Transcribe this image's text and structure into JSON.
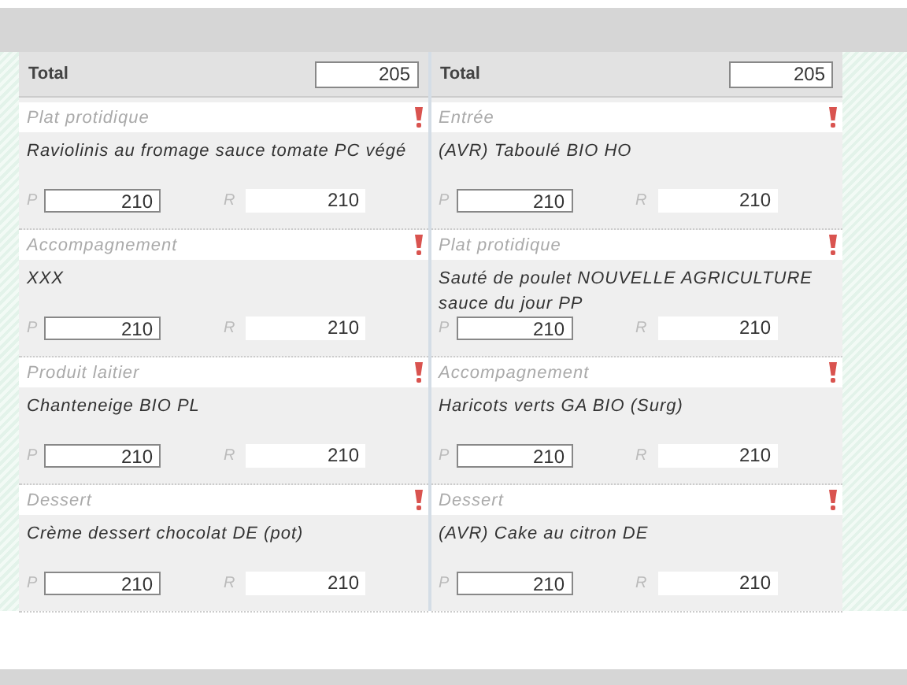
{
  "columns": [
    {
      "total_label": "Total",
      "total_value": "205",
      "sections": [
        {
          "category": "Plat protidique",
          "dish": "Raviolinis au fromage sauce tomate PC végé",
          "p_label": "P",
          "p_value": "210",
          "r_label": "R",
          "r_value": "210"
        },
        {
          "category": "Accompagnement",
          "dish": "XXX",
          "p_label": "P",
          "p_value": "210",
          "r_label": "R",
          "r_value": "210"
        },
        {
          "category": "Produit laitier",
          "dish": "Chanteneige BIO PL",
          "p_label": "P",
          "p_value": "210",
          "r_label": "R",
          "r_value": "210"
        },
        {
          "category": "Dessert",
          "dish": "Crème dessert chocolat DE (pot)",
          "p_label": "P",
          "p_value": "210",
          "r_label": "R",
          "r_value": "210"
        }
      ]
    },
    {
      "total_label": "Total",
      "total_value": "205",
      "sections": [
        {
          "category": "Entrée",
          "dish": "(AVR) Taboulé BIO HO",
          "p_label": "P",
          "p_value": "210",
          "r_label": "R",
          "r_value": "210"
        },
        {
          "category": "Plat protidique",
          "dish": "Sauté de poulet NOUVELLE AGRICULTURE sauce du jour PP",
          "p_label": "P",
          "p_value": "210",
          "r_label": "R",
          "r_value": "210"
        },
        {
          "category": "Accompagnement",
          "dish": "Haricots verts GA BIO (Surg)",
          "p_label": "P",
          "p_value": "210",
          "r_label": "R",
          "r_value": "210"
        },
        {
          "category": "Dessert",
          "dish": "(AVR) Cake au citron DE",
          "p_label": "P",
          "p_value": "210",
          "r_label": "R",
          "r_value": "210"
        }
      ]
    }
  ]
}
